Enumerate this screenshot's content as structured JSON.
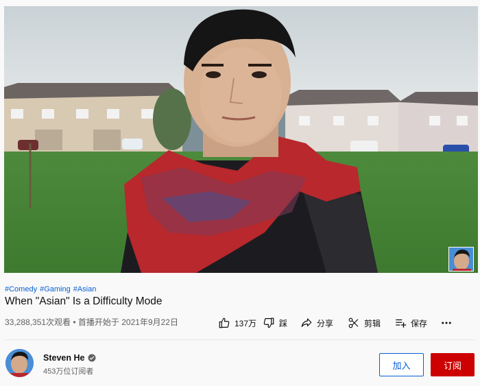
{
  "video": {
    "hashtags": [
      "#Comedy",
      "#Gaming",
      "#Asian"
    ],
    "title": "When \"Asian\" Is a Difficulty Mode",
    "info": "33,288,351次观看 • 首播开始于 2021年9月22日"
  },
  "actions": {
    "like_label": "137万",
    "dislike_label": "踩",
    "share_label": "分享",
    "clip_label": "剪辑",
    "save_label": "保存"
  },
  "channel": {
    "name": "Steven He",
    "subscribers": "453万位订阅者",
    "join_label": "加入",
    "subscribe_label": "订阅"
  },
  "colors": {
    "link": "#065fd4",
    "subscribe": "#cc0000"
  }
}
